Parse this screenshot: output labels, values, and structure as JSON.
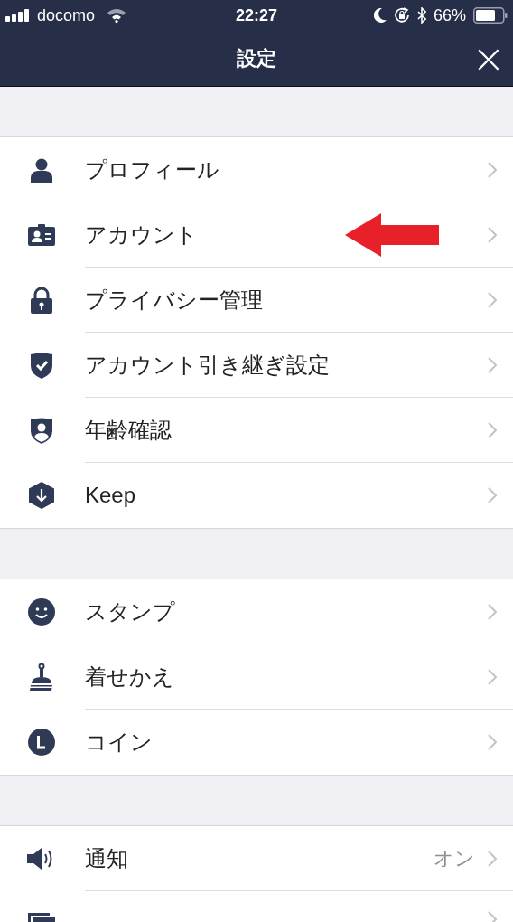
{
  "status_bar": {
    "carrier": "docomo",
    "time": "22:27",
    "battery": "66%"
  },
  "nav_bar": {
    "title": "設定",
    "close": "×"
  },
  "sections": [
    {
      "items": [
        {
          "label": "プロフィール"
        },
        {
          "label": "アカウント",
          "annotated": true
        },
        {
          "label": "プライバシー管理"
        },
        {
          "label": "アカウント引き継ぎ設定"
        },
        {
          "label": "年齢確認"
        },
        {
          "label": "Keep"
        }
      ]
    },
    {
      "items": [
        {
          "label": "スタンプ"
        },
        {
          "label": "着せかえ"
        },
        {
          "label": "コイン"
        }
      ]
    },
    {
      "items": [
        {
          "label": "通知",
          "value": "オン"
        }
      ]
    }
  ]
}
